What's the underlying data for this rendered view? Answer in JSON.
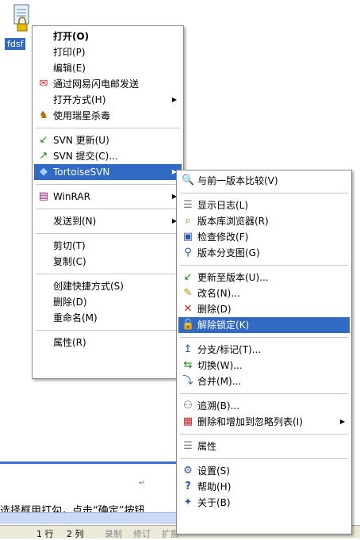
{
  "desktop": {
    "file_label": "fdsf"
  },
  "main_menu": {
    "items": [
      {
        "label": "打开(O)",
        "icon": "none"
      },
      {
        "label": "打印(P)",
        "icon": "none"
      },
      {
        "label": "编辑(E)",
        "icon": "none"
      },
      {
        "label": "通过网易闪电邮发送",
        "icon": "mail-icon"
      },
      {
        "label": "打开方式(H)",
        "icon": "none"
      },
      {
        "label": "使用瑞星杀毒",
        "icon": "antivirus-icon"
      },
      {
        "label": "SVN 更新(U)",
        "icon": "svn-update-icon"
      },
      {
        "label": "SVN 提交(C)...",
        "icon": "svn-commit-icon"
      },
      {
        "label": "TortoiseSVN",
        "icon": "tortoisesvn-icon"
      },
      {
        "label": "WinRAR",
        "icon": "winrar-icon"
      },
      {
        "label": "发送到(N)",
        "icon": "none"
      },
      {
        "label": "剪切(T)",
        "icon": "none"
      },
      {
        "label": "复制(C)",
        "icon": "none"
      },
      {
        "label": "创建快捷方式(S)",
        "icon": "none"
      },
      {
        "label": "删除(D)",
        "icon": "none"
      },
      {
        "label": "重命名(M)",
        "icon": "none"
      },
      {
        "label": "属性(R)",
        "icon": "none"
      }
    ]
  },
  "sub_menu": {
    "items": [
      {
        "label": "与前一版本比较(V)",
        "icon": "diff-icon"
      },
      {
        "label": "显示日志(L)",
        "icon": "log-icon"
      },
      {
        "label": "版本库浏览器(R)",
        "icon": "repo-browser-icon"
      },
      {
        "label": "检查修改(F)",
        "icon": "check-modifications-icon"
      },
      {
        "label": "版本分支图(G)",
        "icon": "revision-graph-icon"
      },
      {
        "label": "更新至版本(U)...",
        "icon": "update-to-revision-icon"
      },
      {
        "label": "改名(N)...",
        "icon": "rename-icon"
      },
      {
        "label": "删除(D)",
        "icon": "delete-icon"
      },
      {
        "label": "解除锁定(K)",
        "icon": "unlock-icon"
      },
      {
        "label": "分支/标记(T)...",
        "icon": "branch-tag-icon"
      },
      {
        "label": "切换(W)...",
        "icon": "switch-icon"
      },
      {
        "label": "合并(M)...",
        "icon": "merge-icon"
      },
      {
        "label": "追溯(B)...",
        "icon": "blame-icon"
      },
      {
        "label": "删除和增加到忽略列表(I)",
        "icon": "ignore-list-icon"
      },
      {
        "label": "属性",
        "icon": "properties-icon"
      },
      {
        "label": "设置(S)",
        "icon": "settings-icon"
      },
      {
        "label": "帮助(H)",
        "icon": "help-icon"
      },
      {
        "label": "关于(B)",
        "icon": "about-icon"
      }
    ]
  },
  "document": {
    "text": "选择框用打勾，点击“确定”按钮",
    "status_line": "1 行",
    "status_col": "2 列",
    "status_rec": "录制",
    "status_trk": "修订",
    "status_ext": "扩展"
  },
  "colors": {
    "highlight": "#316ac5",
    "menu_bg": "#ffffff"
  }
}
